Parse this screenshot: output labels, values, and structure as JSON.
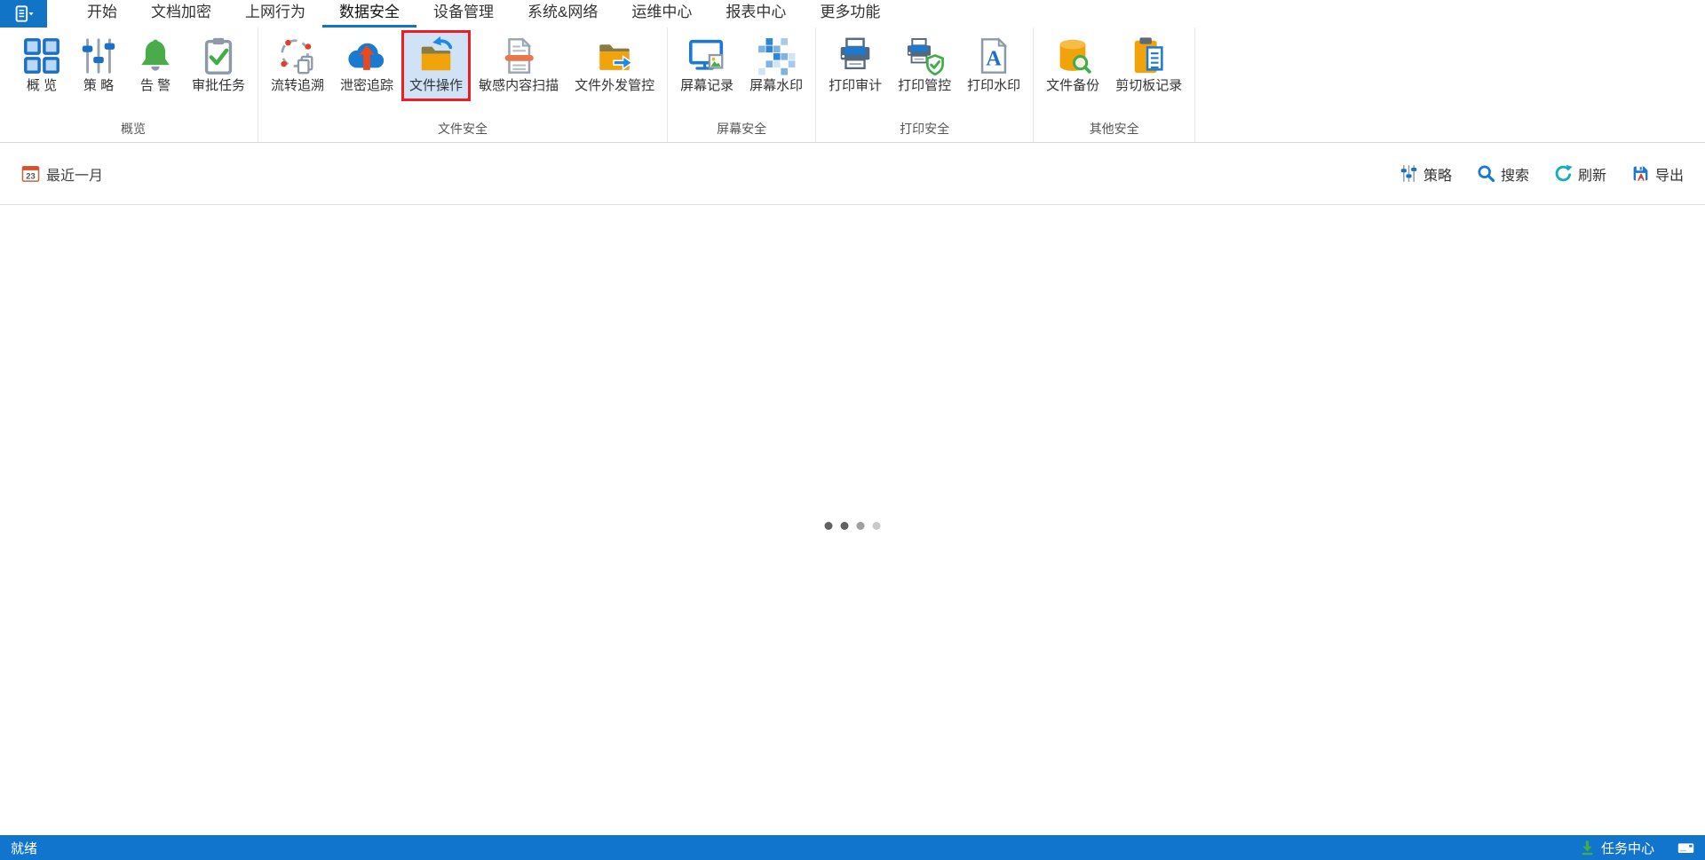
{
  "colors": {
    "accent_blue": "#1274c7",
    "statusbar_blue": "#1175cd",
    "highlight_red": "#ee1d24",
    "highlight_bg": "#cfe2f6"
  },
  "tabs": [
    {
      "name": "home",
      "label": "开始",
      "active": false
    },
    {
      "name": "doc-encryption",
      "label": "文档加密",
      "active": false
    },
    {
      "name": "internet-behavior",
      "label": "上网行为",
      "active": false
    },
    {
      "name": "data-security",
      "label": "数据安全",
      "active": true
    },
    {
      "name": "device-management",
      "label": "设备管理",
      "active": false
    },
    {
      "name": "system-network",
      "label": "系统&网络",
      "active": false
    },
    {
      "name": "ops-center",
      "label": "运维中心",
      "active": false
    },
    {
      "name": "report-center",
      "label": "报表中心",
      "active": false
    },
    {
      "name": "more-features",
      "label": "更多功能",
      "active": false
    }
  ],
  "ribbon": {
    "groups": [
      {
        "name": "overview",
        "label": "概览",
        "items": [
          {
            "name": "overview",
            "label": "概 览",
            "icon": "overview-grid-icon",
            "highlighted": false
          },
          {
            "name": "policy",
            "label": "策 略",
            "icon": "policy-sliders-icon",
            "highlighted": false
          },
          {
            "name": "alert",
            "label": "告 警",
            "icon": "alert-bell-icon",
            "highlighted": false
          },
          {
            "name": "approval-tasks",
            "label": "审批任务",
            "icon": "approval-clipboard-icon",
            "highlighted": false
          }
        ]
      },
      {
        "name": "file-security",
        "label": "文件安全",
        "items": [
          {
            "name": "flow-trace",
            "label": "流转追溯",
            "icon": "trace-flow-icon",
            "highlighted": false
          },
          {
            "name": "leak-tracking",
            "label": "泄密追踪",
            "icon": "leak-track-cloud-icon",
            "highlighted": false
          },
          {
            "name": "file-operation",
            "label": "文件操作",
            "icon": "file-operation-folder-icon",
            "highlighted": true
          },
          {
            "name": "sensitive-content-scan",
            "label": "敏感内容扫描",
            "icon": "sensitive-scan-doc-icon",
            "highlighted": false
          },
          {
            "name": "file-outgoing-control",
            "label": "文件外发管控",
            "icon": "file-outgoing-folder-icon",
            "highlighted": false
          }
        ]
      },
      {
        "name": "screen-security",
        "label": "屏幕安全",
        "items": [
          {
            "name": "screen-recording",
            "label": "屏幕记录",
            "icon": "screen-record-icon",
            "highlighted": false
          },
          {
            "name": "screen-watermark",
            "label": "屏幕水印",
            "icon": "screen-watermark-icon",
            "highlighted": false
          }
        ]
      },
      {
        "name": "print-security",
        "label": "打印安全",
        "items": [
          {
            "name": "print-audit",
            "label": "打印审计",
            "icon": "print-audit-icon",
            "highlighted": false
          },
          {
            "name": "print-control",
            "label": "打印管控",
            "icon": "print-control-icon",
            "highlighted": false
          },
          {
            "name": "print-watermark",
            "label": "打印水印",
            "icon": "print-watermark-icon",
            "highlighted": false
          }
        ]
      },
      {
        "name": "other-security",
        "label": "其他安全",
        "items": [
          {
            "name": "file-backup",
            "label": "文件备份",
            "icon": "file-backup-icon",
            "highlighted": false
          },
          {
            "name": "clipboard-record",
            "label": "剪切板记录",
            "icon": "clipboard-record-icon",
            "highlighted": false
          }
        ]
      }
    ]
  },
  "filter_bar": {
    "date_filter": {
      "label": "最近一月",
      "calendar_day": "23",
      "icon": "calendar-icon"
    },
    "actions": [
      {
        "name": "policy",
        "label": "策略",
        "icon": "policy-sliders-small-icon"
      },
      {
        "name": "search",
        "label": "搜索",
        "icon": "search-icon"
      },
      {
        "name": "refresh",
        "label": "刷新",
        "icon": "refresh-icon"
      },
      {
        "name": "export",
        "label": "导出",
        "icon": "export-icon"
      }
    ]
  },
  "content": {
    "loading_dot_colors": [
      "#616161",
      "#616161",
      "#9e9e9e",
      "#c9c9c9"
    ]
  },
  "statusbar": {
    "ready_text": "就绪",
    "task_center_label": "任务中心"
  }
}
